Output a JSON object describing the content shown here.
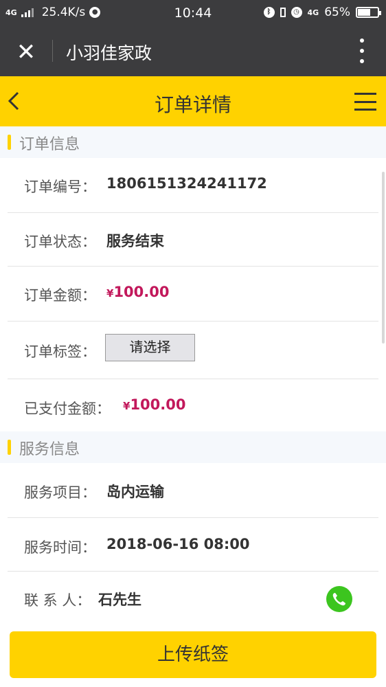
{
  "status_bar": {
    "network": "4G",
    "speed": "25.4K/s",
    "time": "10:44",
    "right_network": "4G",
    "battery": "65%",
    "battery_level": 0.65,
    "icons": [
      "bluetooth-icon",
      "battery-saver-icon",
      "alarm-icon"
    ]
  },
  "app_bar": {
    "title": "小羽佳家政",
    "close_icon": "close-icon",
    "more_icon": "more-vertical-icon"
  },
  "nav": {
    "title": "订单详情",
    "back_icon": "chevron-left-icon",
    "menu_icon": "hamburger-menu-icon"
  },
  "order_section": {
    "title": "订单信息",
    "order_no_label": "订单编号：",
    "order_no": "1806151324241172",
    "status_label": "订单状态：",
    "status": "服务结束",
    "amount_label": "订单金额：",
    "currency": "¥",
    "amount": "100.00",
    "tag_label": "订单标签：",
    "tag_select": "请选择",
    "paid_label": "已支付金额：",
    "paid_amount": "100.00"
  },
  "service_section": {
    "title": "服务信息",
    "item_label": "服务项目：",
    "item": "岛内运输",
    "time_label": "服务时间：",
    "time": "2018-06-16 08:00",
    "contact_label": "联 系 人：",
    "contact": "石先生",
    "phone_icon": "phone-call-icon"
  },
  "footer": {
    "upload_label": "上传纸签"
  },
  "colors": {
    "accent": "#ffd200",
    "money": "#c2185b",
    "phone": "#3cc51f",
    "bar_dark": "#3c3c3e"
  }
}
